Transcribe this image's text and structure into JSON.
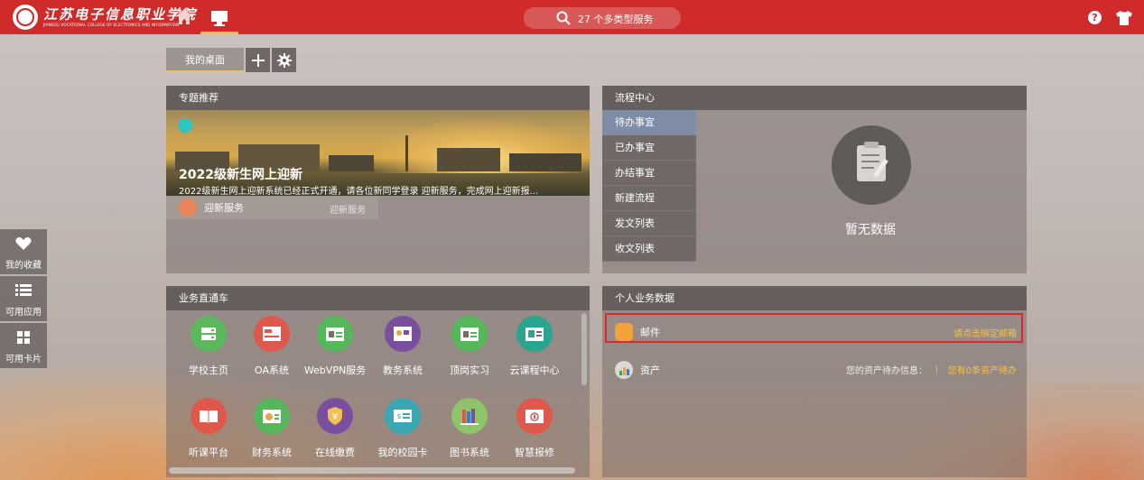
{
  "header": {
    "logo_cn": "江苏电子信息职业学院",
    "logo_en": "JIANGSU VOCATIONAL COLLEGE OF ELECTRONICS AND INFORMATION",
    "search_text": "27 个多类型服务"
  },
  "tabs": {
    "main": "我的桌面"
  },
  "feature_panel": {
    "title": "专题推荐",
    "banner_title": "2022级新生网上迎新",
    "banner_desc": "2022级新生网上迎新系统已经正式开通，请各位新同学登录 迎新服务，完成网上迎新报...",
    "service_name": "迎新服务",
    "service_tag": "迎新服务"
  },
  "flow_panel": {
    "title": "流程中心",
    "items": [
      "待办事宜",
      "已办事宜",
      "办结事宜",
      "新建流程",
      "发文列表",
      "收文列表"
    ],
    "empty_text": "暂无数据"
  },
  "apps_panel": {
    "title": "业务直通车",
    "apps": [
      {
        "label": "学校主页",
        "color": "#5bb85d"
      },
      {
        "label": "OA系统",
        "color": "#e0574b"
      },
      {
        "label": "WebVPN服务",
        "color": "#56b65a"
      },
      {
        "label": "教务系统",
        "color": "#7b4fa0"
      },
      {
        "label": "顶岗实习",
        "color": "#56b65a"
      },
      {
        "label": "云课程中心",
        "color": "#2aa58e"
      },
      {
        "label": "听课平台",
        "color": "#e0574b"
      },
      {
        "label": "财务系统",
        "color": "#56b65a"
      },
      {
        "label": "在线缴费",
        "color": "#7b4fa0"
      },
      {
        "label": "我的校园卡",
        "color": "#3aa7b5"
      },
      {
        "label": "图书系统",
        "color": "#8fc36a"
      },
      {
        "label": "智慧报修",
        "color": "#e0574b"
      }
    ]
  },
  "personal_panel": {
    "title": "个人业务数据",
    "mail_label": "邮件",
    "mail_action": "请点击绑定邮箱",
    "asset_label": "资产",
    "asset_info": "您的资产待办信息：",
    "asset_sep": "|",
    "asset_action": "您有0条资产待办"
  },
  "side": {
    "favorites": "我的收藏",
    "apps": "可用应用",
    "cards": "可用卡片"
  },
  "colors": {
    "brand": "#cf2b2b",
    "accent": "#f2c14e",
    "highlight": "#e0272a"
  }
}
